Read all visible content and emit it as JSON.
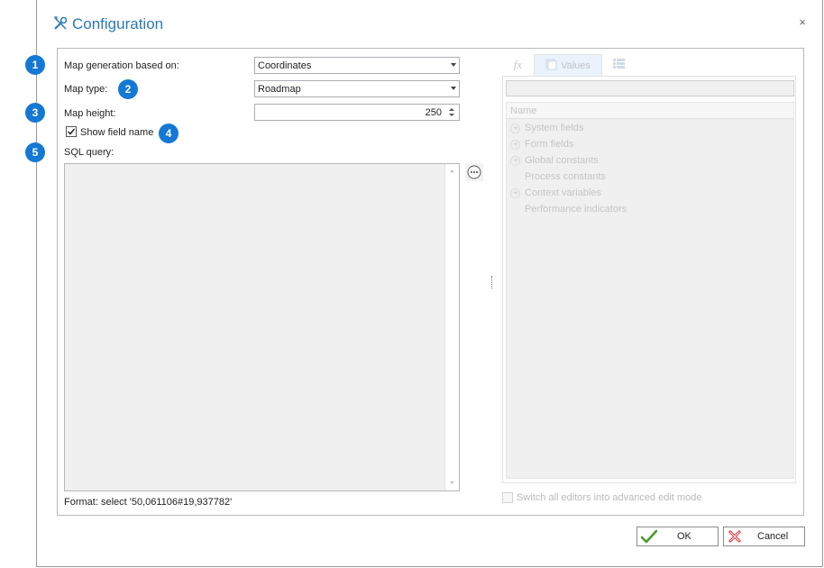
{
  "dialog": {
    "title": "Configuration",
    "close_glyph": "×",
    "accent_color": "#2a7ab8"
  },
  "form": {
    "generation_label": "Map generation based on:",
    "generation_value": "Coordinates",
    "map_type_label": "Map type:",
    "map_type_value": "Roadmap",
    "height_label": "Map height:",
    "height_value": "250",
    "show_field_name_label": "Show field name",
    "show_field_name_checked": true,
    "sql_label": "SQL query:",
    "sql_value": "",
    "format_hint": "Format:  select '50,061106#19,937782'"
  },
  "badges": [
    "1",
    "2",
    "3",
    "4",
    "5"
  ],
  "badge_color": "#1478d4",
  "right_panel": {
    "tabs": [
      {
        "icon": "fx-icon",
        "label": "fx"
      },
      {
        "icon": "values-icon",
        "label": "Values"
      },
      {
        "icon": "list-icon",
        "label": ""
      }
    ],
    "search_value": "",
    "column_header": "Name",
    "items": [
      {
        "label": "System fields",
        "expandable": true
      },
      {
        "label": "Form fields",
        "expandable": true
      },
      {
        "label": "Global constants",
        "expandable": true
      },
      {
        "label": "Process constants",
        "expandable": false
      },
      {
        "label": "Context variables",
        "expandable": true
      },
      {
        "label": "Performance indicators",
        "expandable": false
      }
    ],
    "advanced_mode_label": "Switch all editors into advanced edit mode"
  },
  "buttons": {
    "ok_label": "OK",
    "cancel_label": "Cancel"
  }
}
